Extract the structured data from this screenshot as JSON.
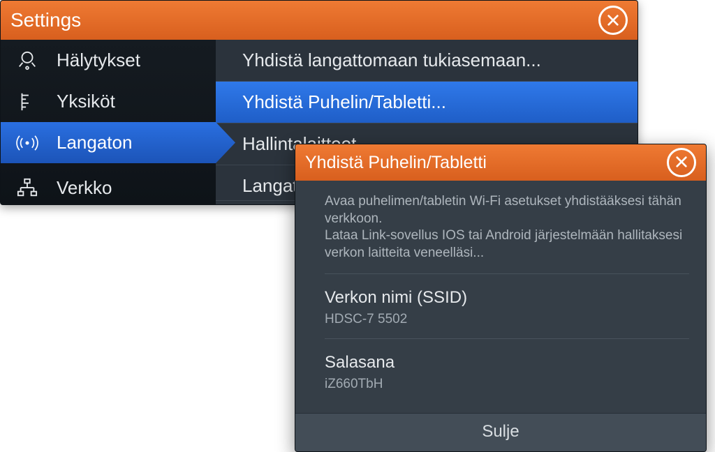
{
  "colors": {
    "accent": "#e5671e",
    "selected_blue": "#2262cf",
    "panel_dark": "#111820",
    "panel_mid": "#2b333c"
  },
  "window": {
    "title": "Settings"
  },
  "sidebar": {
    "items": [
      {
        "id": "alerts",
        "label": "Hälytykset",
        "selected": false
      },
      {
        "id": "units",
        "label": "Yksiköt",
        "selected": false
      },
      {
        "id": "wireless",
        "label": "Langaton",
        "selected": true
      },
      {
        "id": "network",
        "label": "Verkko",
        "selected": false
      }
    ]
  },
  "detail": {
    "items": [
      {
        "id": "connect-ap",
        "label": "Yhdistä langattomaan tukiasemaan...",
        "selected": false
      },
      {
        "id": "connect-phone",
        "label": "Yhdistä Puhelin/Tabletti...",
        "selected": true
      },
      {
        "id": "controllers",
        "label": "Hallintalaitteet",
        "selected": false
      },
      {
        "id": "wireless-more",
        "label": "Langatt",
        "selected": false
      }
    ]
  },
  "dialog": {
    "title": "Yhdistä Puhelin/Tabletti",
    "intro_line1": "Avaa puhelimen/tabletin Wi-Fi asetukset yhdistääksesi tähän verkkoon.",
    "intro_line2": "Lataa Link-sovellus IOS tai Android järjestelmään hallitaksesi verkon laitteita veneelläsi...",
    "ssid_label": "Verkon nimi (SSID)",
    "ssid_value": "HDSC-7 5502",
    "password_label": "Salasana",
    "password_value": "iZ660TbH",
    "close_label": "Sulje"
  }
}
